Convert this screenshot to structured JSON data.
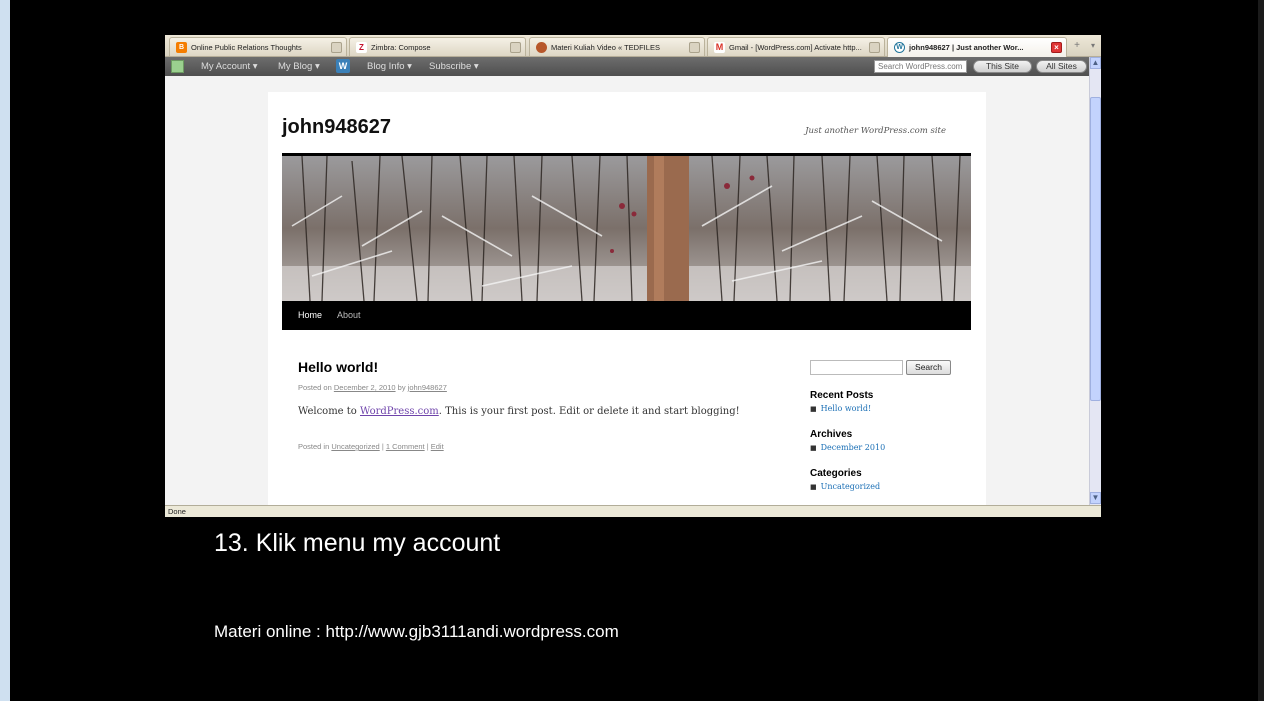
{
  "browser": {
    "tabs": [
      {
        "label": "Online Public Relations Thoughts",
        "icon": "blogger-icon"
      },
      {
        "label": "Zimbra: Compose",
        "icon": "zimbra-icon"
      },
      {
        "label": "Materi Kuliah Video « TEDFILES",
        "icon": "tedfiles-icon"
      },
      {
        "label": "Gmail - [WordPress.com] Activate http...",
        "icon": "gmail-icon"
      },
      {
        "label": "john948627 | Just another Wor...",
        "icon": "wordpress-icon",
        "active": true
      }
    ],
    "status": "Done"
  },
  "adminbar": {
    "my_account": "My Account ▾",
    "my_blog": "My Blog ▾",
    "blog_info": "Blog Info ▾",
    "subscribe": "Subscribe ▾",
    "search_placeholder": "Search WordPress.com",
    "this_site": "This Site",
    "all_sites": "All Sites"
  },
  "site": {
    "title": "john948627",
    "description": "Just another WordPress.com site",
    "nav": [
      "Home",
      "About"
    ]
  },
  "post": {
    "title": "Hello world!",
    "meta_prefix": "Posted on ",
    "date": "December 2, 2010",
    "meta_by": " by ",
    "author": "john948627",
    "body_prefix": "Welcome to ",
    "body_link": "WordPress.com",
    "body_suffix": ". This is your first post. Edit or delete it and start blogging!",
    "posted_in": "Posted in ",
    "category": "Uncategorized",
    "sep": " | ",
    "comments": "1 Comment",
    "edit": "Edit"
  },
  "sidebar": {
    "search_button": "Search",
    "recent_posts_heading": "Recent Posts",
    "recent_posts": [
      "Hello world!"
    ],
    "archives_heading": "Archives",
    "archives": [
      "December 2010"
    ],
    "categories_heading": "Categories",
    "categories": [
      "Uncategorized"
    ]
  },
  "slide": {
    "caption": "13. Klik menu my account",
    "footnote": "Materi online : http://www.gjb3111andi.wordpress.com"
  }
}
